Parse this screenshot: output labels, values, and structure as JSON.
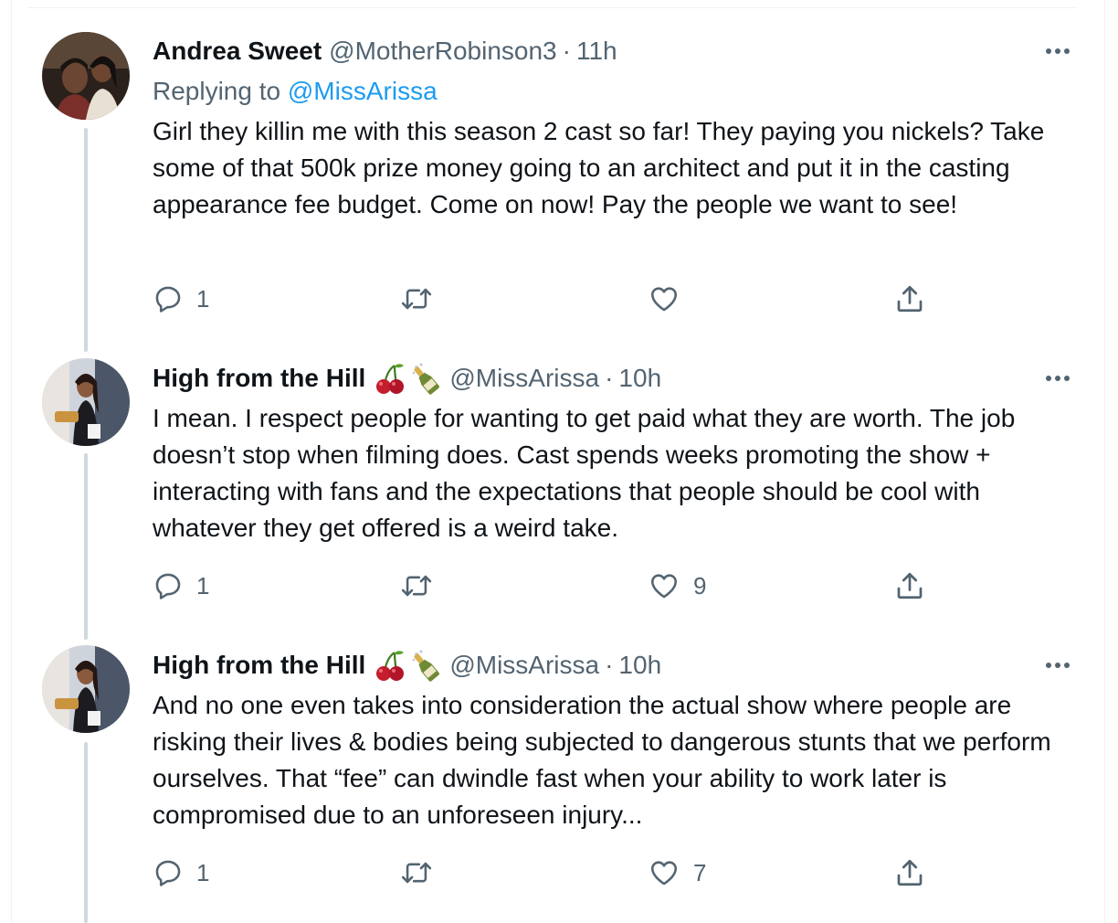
{
  "tweets": [
    {
      "display_name": "Andrea Sweet",
      "handle": "@MotherRobinson3",
      "separator": "·",
      "time": "11h",
      "replying_prefix": "Replying to ",
      "replying_to": "@MissArissa",
      "text": "Girl they killin me with this season 2 cast so far! They paying you nickels? Take some of that 500k prize money going to an architect and put it in the casting appearance fee budget.  Come on now! Pay the people we want to see!",
      "reply_count": "1",
      "retweet_count": "",
      "like_count": "",
      "icons": {
        "reply": "reply-icon",
        "retweet": "retweet-icon",
        "like": "heart-icon",
        "share": "share-icon",
        "more": "more-icon"
      }
    },
    {
      "display_name": "High from the Hill",
      "emoji": [
        "cherries",
        "champagne-bottle"
      ],
      "handle": "@MissArissa",
      "separator": "·",
      "time": "10h",
      "text": "I mean. I respect people for wanting to get paid what they are worth. The job doesn’t stop when filming does. Cast spends weeks promoting the show + interacting with fans and the expectations that people should be cool with whatever they get offered is a weird take.",
      "reply_count": "1",
      "retweet_count": "",
      "like_count": "9"
    },
    {
      "display_name": "High from the Hill",
      "emoji": [
        "cherries",
        "champagne-bottle"
      ],
      "handle": "@MissArissa",
      "separator": "·",
      "time": "10h",
      "text": "And no one even takes into consideration the actual show where people are risking their lives & bodies being subjected to dangerous stunts that we perform ourselves. That “fee” can dwindle fast when your ability to work later is compromised due to an unforeseen injury...",
      "reply_count": "1",
      "retweet_count": "",
      "like_count": "7"
    }
  ],
  "colors": {
    "text": "#0f1419",
    "secondary": "#536471",
    "link": "#1d9bf0",
    "thread_line": "#cfd9de"
  }
}
